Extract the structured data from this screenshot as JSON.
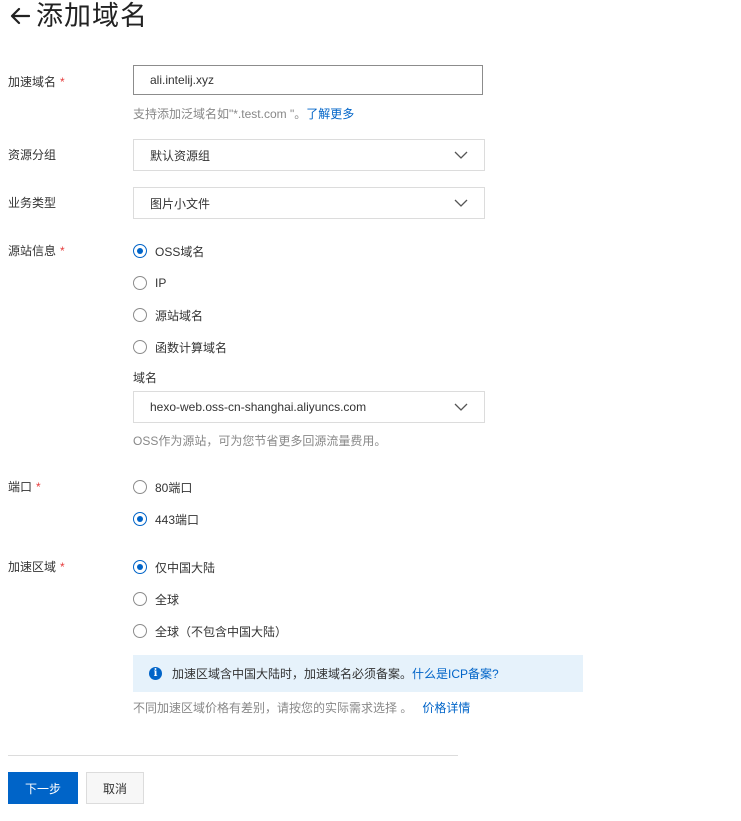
{
  "header": {
    "title": "添加域名",
    "back_icon": "arrow-left-icon"
  },
  "form": {
    "domain": {
      "label": "加速域名",
      "required_mark": "*",
      "value": "ali.intelij.xyz",
      "hint": "支持添加泛域名如\"*.test.com \"。",
      "hint_link": "了解更多"
    },
    "resource_group": {
      "label": "资源分组",
      "selected": "默认资源组"
    },
    "business_type": {
      "label": "业务类型",
      "selected": "图片小文件"
    },
    "origin": {
      "label": "源站信息",
      "required_mark": "*",
      "options": [
        {
          "label": "OSS域名",
          "checked": true
        },
        {
          "label": "IP",
          "checked": false
        },
        {
          "label": "源站域名",
          "checked": false
        },
        {
          "label": "函数计算域名",
          "checked": false
        }
      ],
      "domain_label": "域名",
      "domain_selected": "hexo-web.oss-cn-shanghai.aliyuncs.com",
      "hint": "OSS作为源站，可为您节省更多回源流量费用。"
    },
    "port": {
      "label": "端口",
      "required_mark": "*",
      "options": [
        {
          "label": "80端口",
          "checked": false
        },
        {
          "label": "443端口",
          "checked": true
        }
      ]
    },
    "region": {
      "label": "加速区域",
      "required_mark": "*",
      "options": [
        {
          "label": "仅中国大陆",
          "checked": true
        },
        {
          "label": "全球",
          "checked": false
        },
        {
          "label": "全球（不包含中国大陆）",
          "checked": false
        }
      ],
      "info_text": "加速区域含中国大陆时，加速域名必须备案。",
      "info_link": "什么是ICP备案?",
      "info_icon_glyph": "i",
      "hint": "不同加速区域价格有差别，请按您的实际需求选择 。",
      "hint_link": "价格详情"
    }
  },
  "actions": {
    "next": "下一步",
    "cancel": "取消"
  },
  "colors": {
    "primary": "#0064c8",
    "required": "#e63c3c",
    "info_bg": "#e6f2fb"
  }
}
